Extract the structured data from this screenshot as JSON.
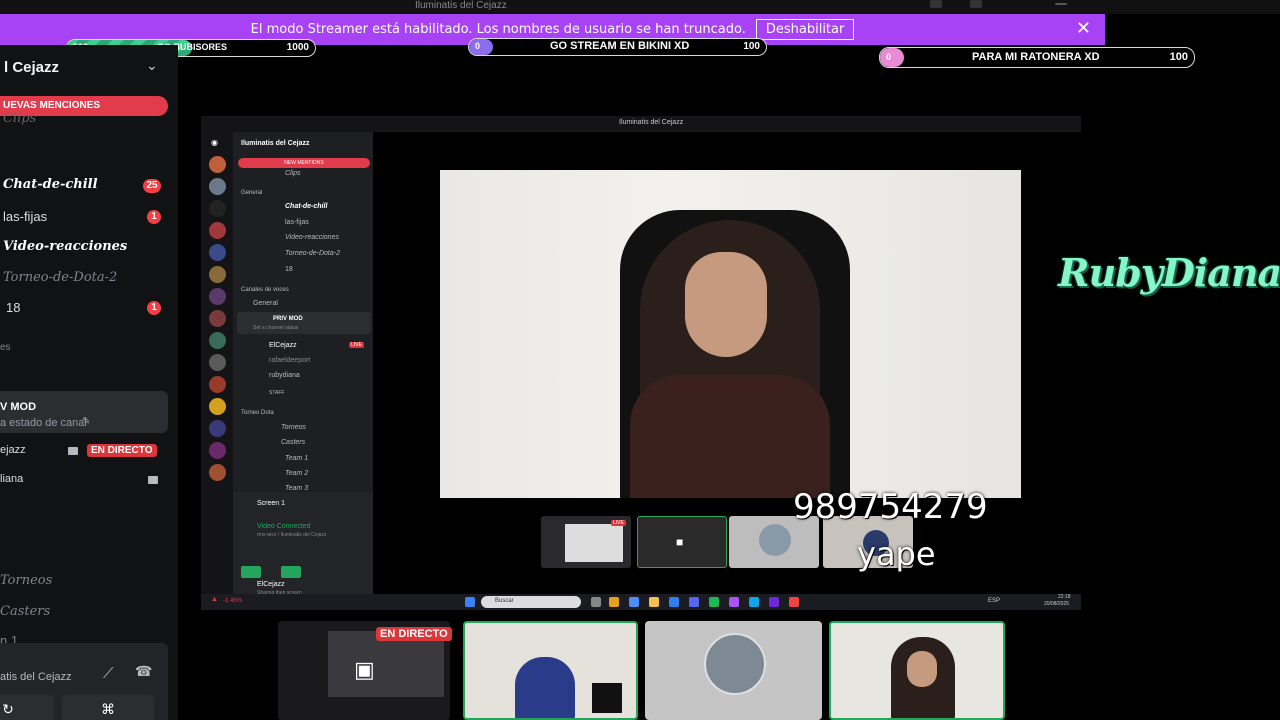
{
  "window": {
    "title": "Iluminatis del Cejazz"
  },
  "banner": {
    "text": "El modo Streamer está habilitado. Los nombres de usuario se han truncado.",
    "button": "Deshabilitar",
    "close_icon": "close-icon"
  },
  "goals": [
    {
      "left": "506",
      "center": "GO BUBISORES",
      "right": "1000",
      "progress": 0.506,
      "color": "#3ecf8e"
    },
    {
      "left": "0",
      "center": "GO STREAM EN BIKINI XD",
      "right": "100",
      "progress": 0.0,
      "color": "#8b6cf0"
    },
    {
      "left": "0",
      "center": "PARA MI RATONERA XD",
      "right": "100",
      "progress": 0.0,
      "color": "#e88ad6"
    }
  ],
  "sidebar": {
    "server_name": "l Cejazz",
    "mentions_pill": "UEVAS MENCIONES",
    "channels": [
      {
        "label": "Clips"
      },
      {
        "label": "Chat-de-chill",
        "badge": "25"
      },
      {
        "label": "las-fijas",
        "badge": "1"
      },
      {
        "label": "Video-reacciones"
      },
      {
        "label": "Torneo-de-Dota-2"
      },
      {
        "label": "18",
        "badge": "1"
      },
      {
        "label": "es"
      }
    ],
    "voice": {
      "title": "V MOD",
      "status": "a estado de canal"
    },
    "voice_users": [
      {
        "name": "ejazz",
        "live": "EN DIRECTO"
      },
      {
        "name": "liana"
      }
    ],
    "more_channels": [
      "Torneos",
      "Casters",
      "n 1"
    ],
    "panel_text": "atis del Cejazz"
  },
  "capture": {
    "title": "Iluminatis del Cejazz",
    "server_name": "Iluminatis del Cejazz",
    "new_mentions": "NEW MENTIONS",
    "channels": [
      "Clips",
      "General",
      "Chat-de-chill",
      "las-fijas",
      "Video-reacciones",
      "Torneo-de-Dota-2",
      "18",
      "Canales de voces",
      "General",
      "PRIV MOD",
      "Set a channel status",
      "ElCejazz",
      "rafaeldeeport",
      "rubydiana",
      "STAFF",
      "Torneo Dota",
      "Torneos",
      "Casters",
      "Team 1",
      "Team 2",
      "Team 3"
    ],
    "live_tag": "LIVE",
    "screen_label": "Screen 1",
    "video_connected": "Video Connected",
    "video_sub": "rmx-arcx / Iluminatis del Cejazz",
    "user_name": "ElCejazz",
    "user_status": "Sharing their screen",
    "search_placeholder": "Buscar",
    "tray_lang": "ESP",
    "clock_time": "22:18",
    "clock_date": "20/08/2025",
    "ticker": "-1.45%",
    "thumb_live": "LIVE"
  },
  "overlay": {
    "phone": "989754279",
    "yape": "yape",
    "streamer_logo": "RubyDiana"
  },
  "bottom": {
    "live_badge": "EN DIRECTO"
  }
}
